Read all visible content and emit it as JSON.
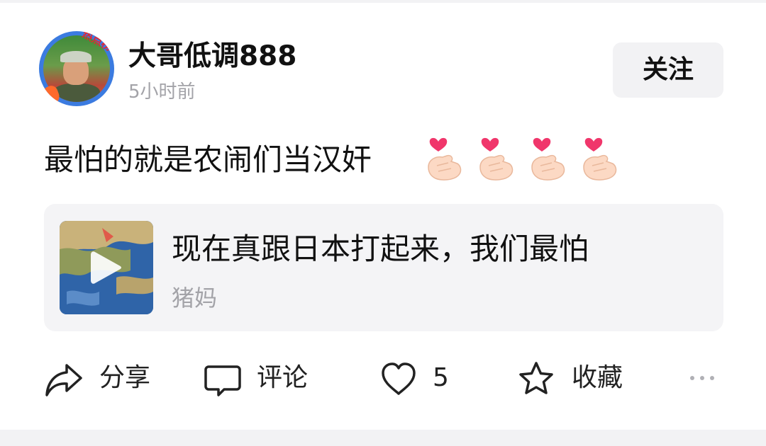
{
  "post": {
    "author": {
      "name": "大哥低调888",
      "avatar_badge": "热点榜",
      "time": "5小时前"
    },
    "follow_label": "关注",
    "text": "最怕的就是农闹们当汉奸",
    "emoji": [
      "heart-finger-icon",
      "heart-finger-icon",
      "heart-finger-icon",
      "heart-finger-icon"
    ],
    "link_card": {
      "title": "现在真跟日本打起来，我们最怕",
      "source": "猪妈",
      "thumbnail_icon": "map-video-thumbnail",
      "play_icon": "play-icon"
    }
  },
  "actions": {
    "share_label": "分享",
    "comment_label": "评论",
    "like_count": "5",
    "favorite_label": "收藏",
    "more_icon": "more-dots-icon"
  },
  "colors": {
    "text_primary": "#111111",
    "text_secondary": "#a3a3a8",
    "card_background": "#f4f4f6",
    "follow_button_background": "#f2f2f4",
    "badge_red": "#e8252f",
    "avatar_ring": "#3b7be0"
  }
}
